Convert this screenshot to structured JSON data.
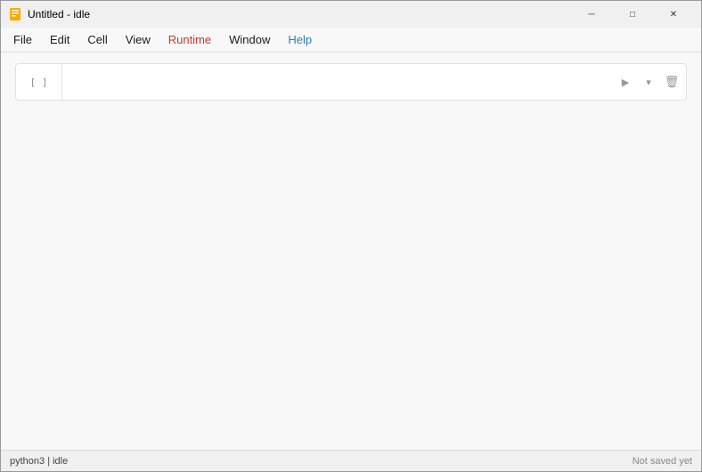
{
  "titleBar": {
    "title": "Untitled - idle",
    "appIconLabel": "notebook-icon"
  },
  "windowControls": {
    "minimize": "─",
    "maximize": "□",
    "close": "✕"
  },
  "menuBar": {
    "items": [
      {
        "label": "File",
        "class": "menu-file"
      },
      {
        "label": "Edit",
        "class": "menu-edit"
      },
      {
        "label": "Cell",
        "class": "menu-cell"
      },
      {
        "label": "View",
        "class": "menu-view"
      },
      {
        "label": "Runtime",
        "class": "menu-runtime"
      },
      {
        "label": "Window",
        "class": "menu-window"
      },
      {
        "label": "Help",
        "class": "menu-help"
      }
    ]
  },
  "cell": {
    "gutter": "[ ]",
    "placeholder": "",
    "run_arrow": "▶",
    "chevron_down": "▾",
    "delete_icon": "🗑"
  },
  "statusBar": {
    "left": "python3 | idle",
    "right": "Not saved yet"
  }
}
